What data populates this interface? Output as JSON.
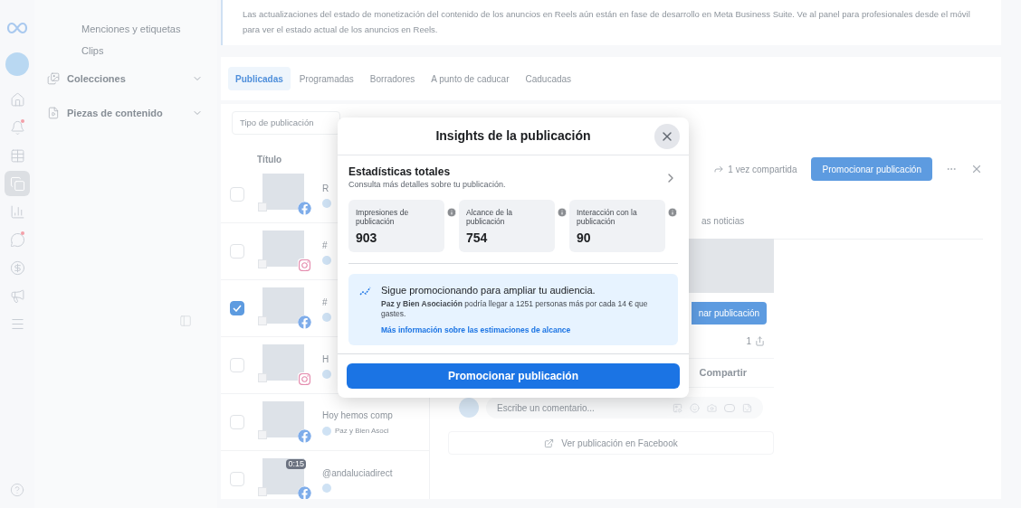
{
  "rail_items": [
    {
      "selected": false,
      "alert": false
    },
    {
      "selected": false,
      "alert": true
    },
    {
      "selected": false,
      "alert": false
    },
    {
      "selected": true,
      "alert": false
    },
    {
      "selected": false,
      "alert": false
    },
    {
      "selected": false,
      "alert": true
    },
    {
      "selected": false,
      "alert": false
    },
    {
      "selected": false,
      "alert": false
    },
    {
      "selected": false,
      "alert": false
    }
  ],
  "nav_items": [
    {
      "label": "Menciones y etiquetas",
      "kind": "link"
    },
    {
      "label": "Clips",
      "kind": "link"
    },
    {
      "label": "Colecciones",
      "kind": "group",
      "expanded": false
    },
    {
      "label": "Piezas de contenido",
      "kind": "group",
      "expanded": false
    }
  ],
  "notice": {
    "text": "Las actualizaciones del estado de monetización del contenido de los anuncios en Reels aún están en fase de desarrollo en Meta Business Suite. Ve al panel para profesionales desde el móvil para ver el estado actual de los anuncios en Reels."
  },
  "tabs": [
    {
      "label": "Publicadas",
      "selected": true
    },
    {
      "label": "Programadas",
      "selected": false
    },
    {
      "label": "Borradores",
      "selected": false
    },
    {
      "label": "A punto de caducar",
      "selected": false
    },
    {
      "label": "Caducadas",
      "selected": false
    }
  ],
  "filter": {
    "placeholder": "Tipo de publicación"
  },
  "table": {
    "columns": [
      "Título"
    ],
    "rows": [
      {
        "selected": false,
        "kind": "facebook",
        "title": "R"
      },
      {
        "selected": false,
        "kind": "instagram",
        "title": "#"
      },
      {
        "selected": true,
        "kind": "facebook",
        "title": "#"
      },
      {
        "selected": false,
        "kind": "instagram",
        "title": "H"
      },
      {
        "selected": false,
        "kind": "facebook",
        "title": "Hoy hemos comp",
        "author": "Paz y Bien Asoci"
      },
      {
        "selected": false,
        "kind": "facebook",
        "title": "@andaluciadirect",
        "duration": "0:15"
      }
    ]
  },
  "detail": {
    "share_count_button": "1 vez compartida",
    "promote_button": "Promocionar publicación",
    "tab_fragment": "as noticias",
    "promote_fragment": "nar publicación",
    "share_count": "1",
    "share_action": "Compartir",
    "comment_placeholder": "Escribe un comentario...",
    "view_link": "Ver publicación en Facebook"
  },
  "modal": {
    "title": "Insights de la publicación",
    "section_title": "Estadísticas totales",
    "section_subtitle": "Consulta más detalles sobre tu publicación.",
    "metrics": [
      {
        "label": "Impresiones de publicación",
        "value": "903"
      },
      {
        "label": "Alcance de la publicación",
        "value": "754"
      },
      {
        "label": "Interacción con la publicación",
        "value": "90"
      }
    ],
    "promo": {
      "heading": "Sigue promocionando para ampliar tu audiencia.",
      "body": "**Paz y Bien Asociación** podría llegar a 1251 personas más por cada 14 € que gastes.",
      "link": "Más información sobre las estimaciones de alcance"
    },
    "button": "Promocionar publicación"
  }
}
